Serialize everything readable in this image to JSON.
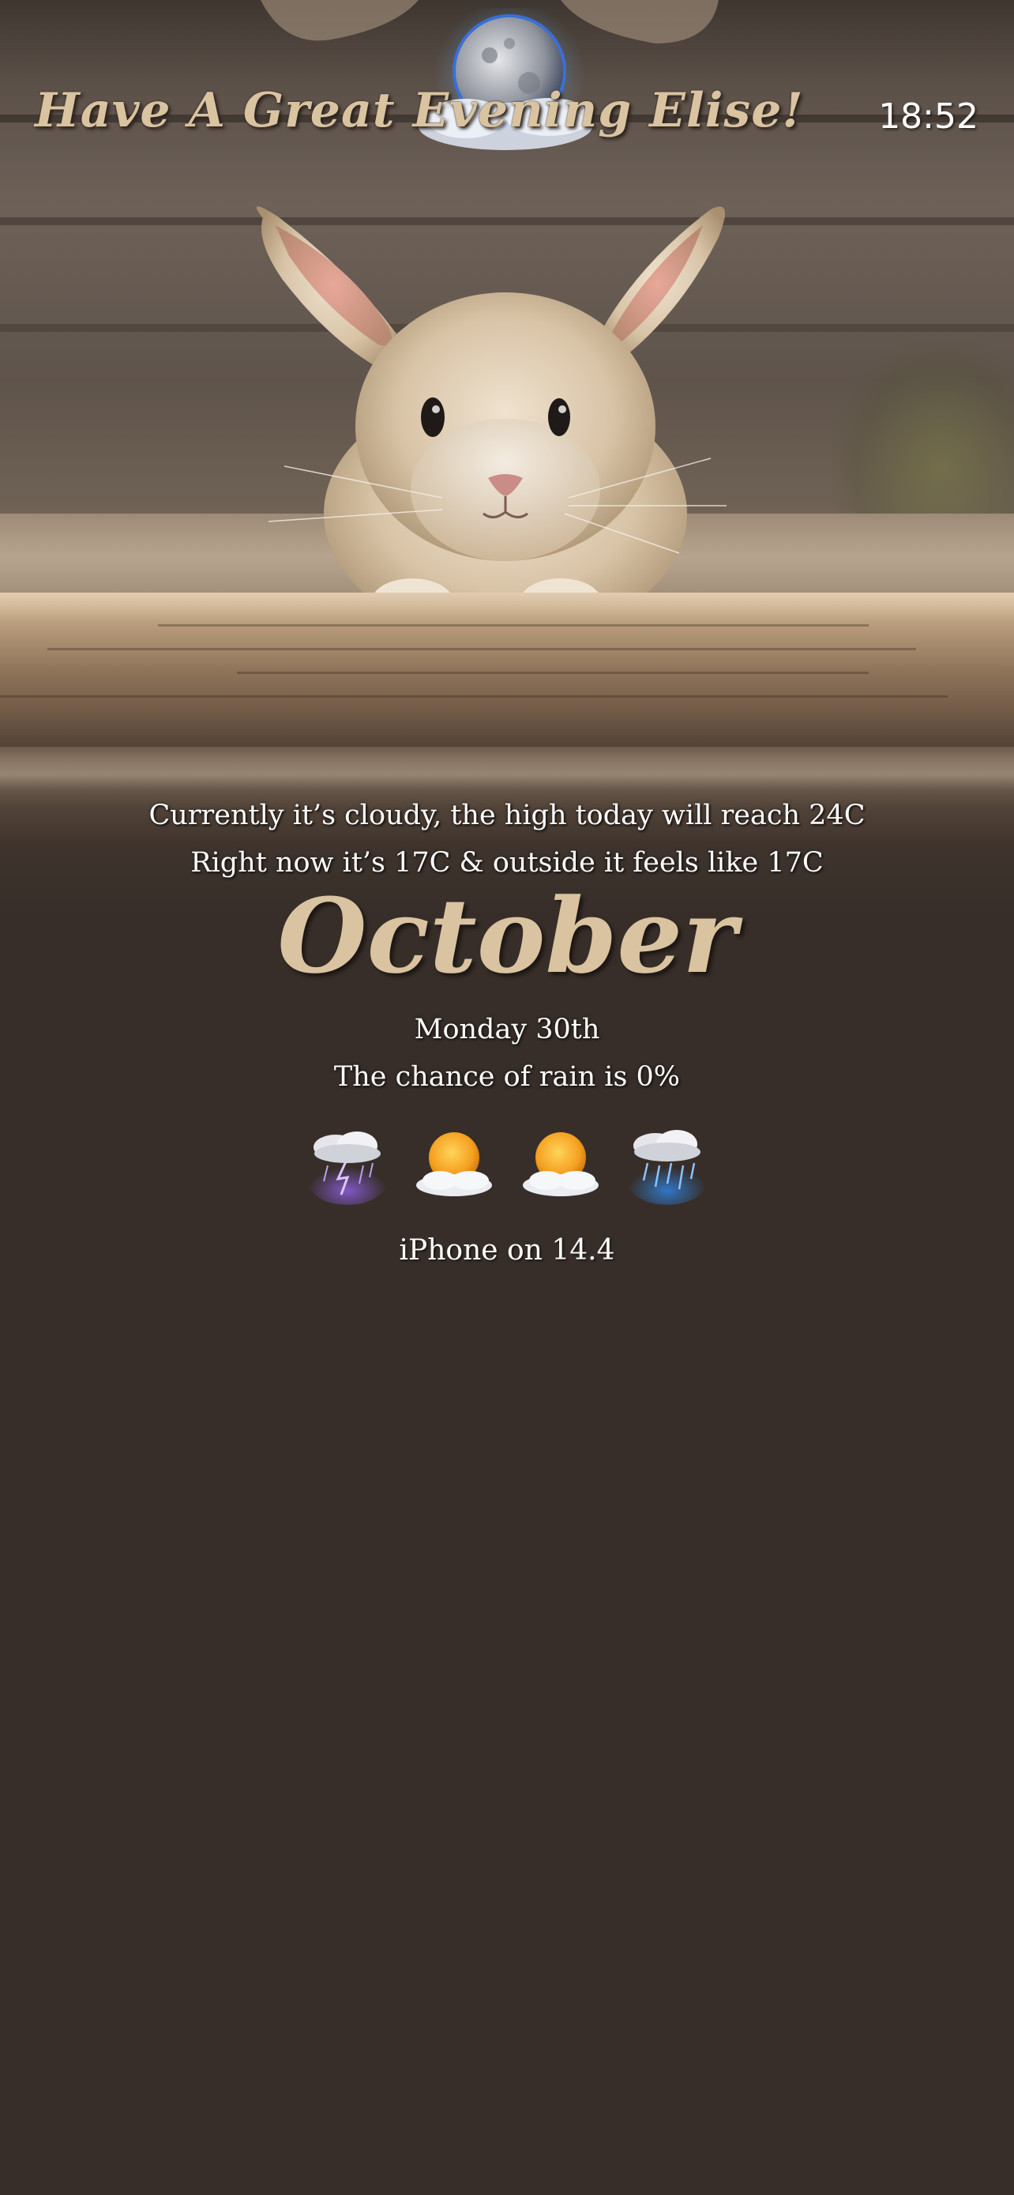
{
  "greeting": "Have A Great Evening Elise!",
  "time": "18:52",
  "weather": {
    "summary": "Currently it’s cloudy, the high today will reach 24C",
    "now": "Right now it’s 17C & outside it feels like 17C",
    "rain": "The chance of rain is 0%"
  },
  "date": {
    "month": "October",
    "day": "Monday 30th"
  },
  "forecast_icons": [
    "thunderstorm-icon",
    "partly-sunny-icon",
    "partly-sunny-icon",
    "rain-icon"
  ],
  "battery": "iPhone on 14.4",
  "colors": {
    "accent": "#d9c3a0",
    "background": "#372e29",
    "text": "#ffffff"
  }
}
